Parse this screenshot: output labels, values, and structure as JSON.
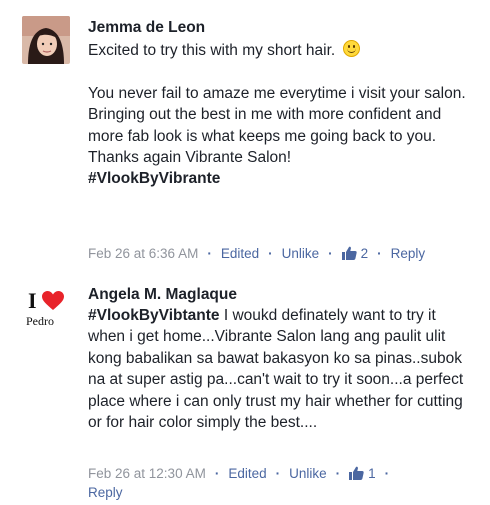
{
  "comments": [
    {
      "author": "Jemma de Leon",
      "first_line": "Excited to try this with my short hair.",
      "paragraphs": [
        "You never fail to amaze me everytime i visit your salon.",
        "Bringing out the best in me with more confident and more fab look is what keeps me going back to you.",
        "Thanks again Vibrante Salon!"
      ],
      "hashtag": "#VlookByVibrante",
      "timestamp": "Feb 26 at 6:36 AM",
      "edited_label": "Edited",
      "unlike_label": "Unlike",
      "like_count": "2",
      "reply_label": "Reply",
      "icons": {
        "emoji": "smiley-emoji-icon",
        "like": "thumbs-up-icon"
      }
    },
    {
      "author": "Angela M. Maglaque",
      "hashtag": "#VlookByVibtante",
      "text": "I woukd definately want to try it when i get home...Vibrante Salon lang ang paulit ulit kong babalikan sa bawat bakasyon ko sa pinas..subok na at super astig pa...can't wait to try it soon...a perfect place where i can only trust my hair whether for cutting or for hair color simply the best....",
      "timestamp": "Feb 26 at 12:30 AM",
      "edited_label": "Edited",
      "unlike_label": "Unlike",
      "like_count": "1",
      "reply_label": "Reply",
      "avatar_logo": {
        "letter": "I",
        "word": "Pedro"
      },
      "icons": {
        "like": "thumbs-up-icon",
        "avatar_heart": "heart-icon"
      }
    }
  ],
  "colors": {
    "link": "#4b67a1",
    "meta": "#90949c",
    "text": "#1d2129",
    "heart": "#e8232a"
  }
}
